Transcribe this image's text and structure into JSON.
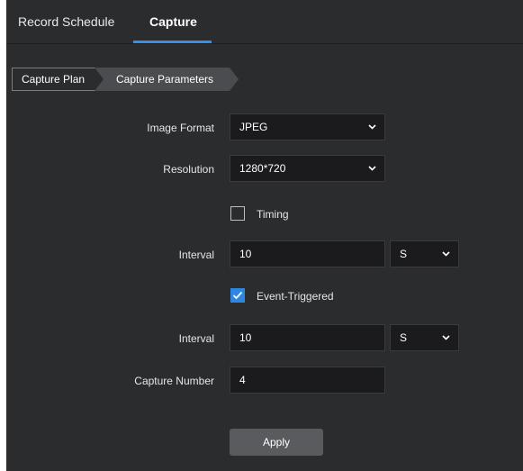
{
  "tabs": [
    {
      "label": "Record Schedule"
    },
    {
      "label": "Capture"
    }
  ],
  "breadcrumb": [
    {
      "label": "Capture Plan"
    },
    {
      "label": "Capture Parameters"
    }
  ],
  "form": {
    "image_format": {
      "label": "Image Format",
      "value": "JPEG"
    },
    "resolution": {
      "label": "Resolution",
      "value": "1280*720"
    },
    "timing": {
      "label": "Timing",
      "checked": false
    },
    "timing_interval": {
      "label": "Interval",
      "value": "10",
      "unit": "S"
    },
    "event_triggered": {
      "label": "Event-Triggered",
      "checked": true
    },
    "event_interval": {
      "label": "Interval",
      "value": "10",
      "unit": "S"
    },
    "capture_number": {
      "label": "Capture Number",
      "value": "4"
    }
  },
  "apply_label": "Apply",
  "colors": {
    "accent": "#2f86e0",
    "background": "#2b2c2e",
    "input_bg": "#1b1b1d",
    "button_bg": "#5a5b5e"
  }
}
